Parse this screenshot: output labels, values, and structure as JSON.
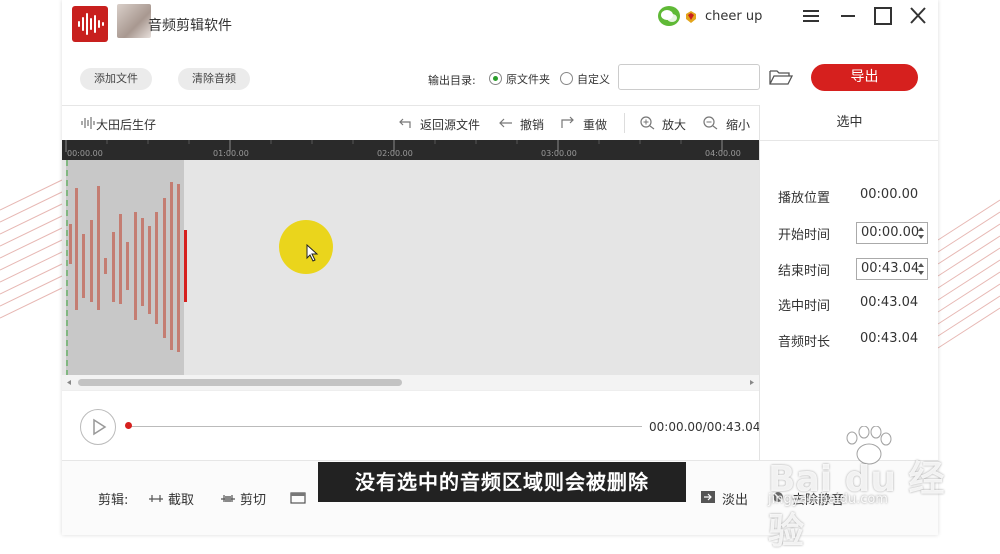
{
  "app": {
    "title": "音频剪辑软件",
    "user_name": "cheer up",
    "accent_color": "#d6201e"
  },
  "toolbar": {
    "add_file": "添加文件",
    "clear_audio": "清除音频",
    "output_dir_label": "输出目录:",
    "option_source_folder": "原文件夹",
    "option_custom": "自定义",
    "selected_option": "原文件夹",
    "path_value": "",
    "export_label": "导出"
  },
  "editor_toolbar": {
    "file_name": "大田后生仔",
    "revert": "返回源文件",
    "undo": "撤销",
    "redo": "重做",
    "zoom_in": "放大",
    "zoom_out": "缩小"
  },
  "timeline": {
    "ticks": [
      "00:00.00",
      "01:00.00",
      "02:00.00",
      "03:00.00",
      "04:00.00"
    ]
  },
  "player": {
    "time_readout": "00:00.00/00:43.04",
    "progress_fraction": 0
  },
  "side_panel": {
    "title": "选中",
    "play_position_label": "播放位置",
    "play_position_value": "00:00.00",
    "start_time_label": "开始时间",
    "start_time_value": "00:00.00",
    "end_time_label": "结束时间",
    "end_time_value": "00:43.04",
    "selected_time_label": "选中时间",
    "selected_time_value": "00:43.04",
    "duration_label": "音频时长",
    "duration_value": "00:43.04"
  },
  "edit_bar": {
    "label": "剪辑:",
    "crop": "截取",
    "cut": "剪切",
    "fade_out": "淡出",
    "remove_silence": "去除静音"
  },
  "caption": "没有选中的音频区域则会被删除",
  "watermark": {
    "text": "Bai du 经验",
    "url": "jingyan.baidu.com"
  }
}
